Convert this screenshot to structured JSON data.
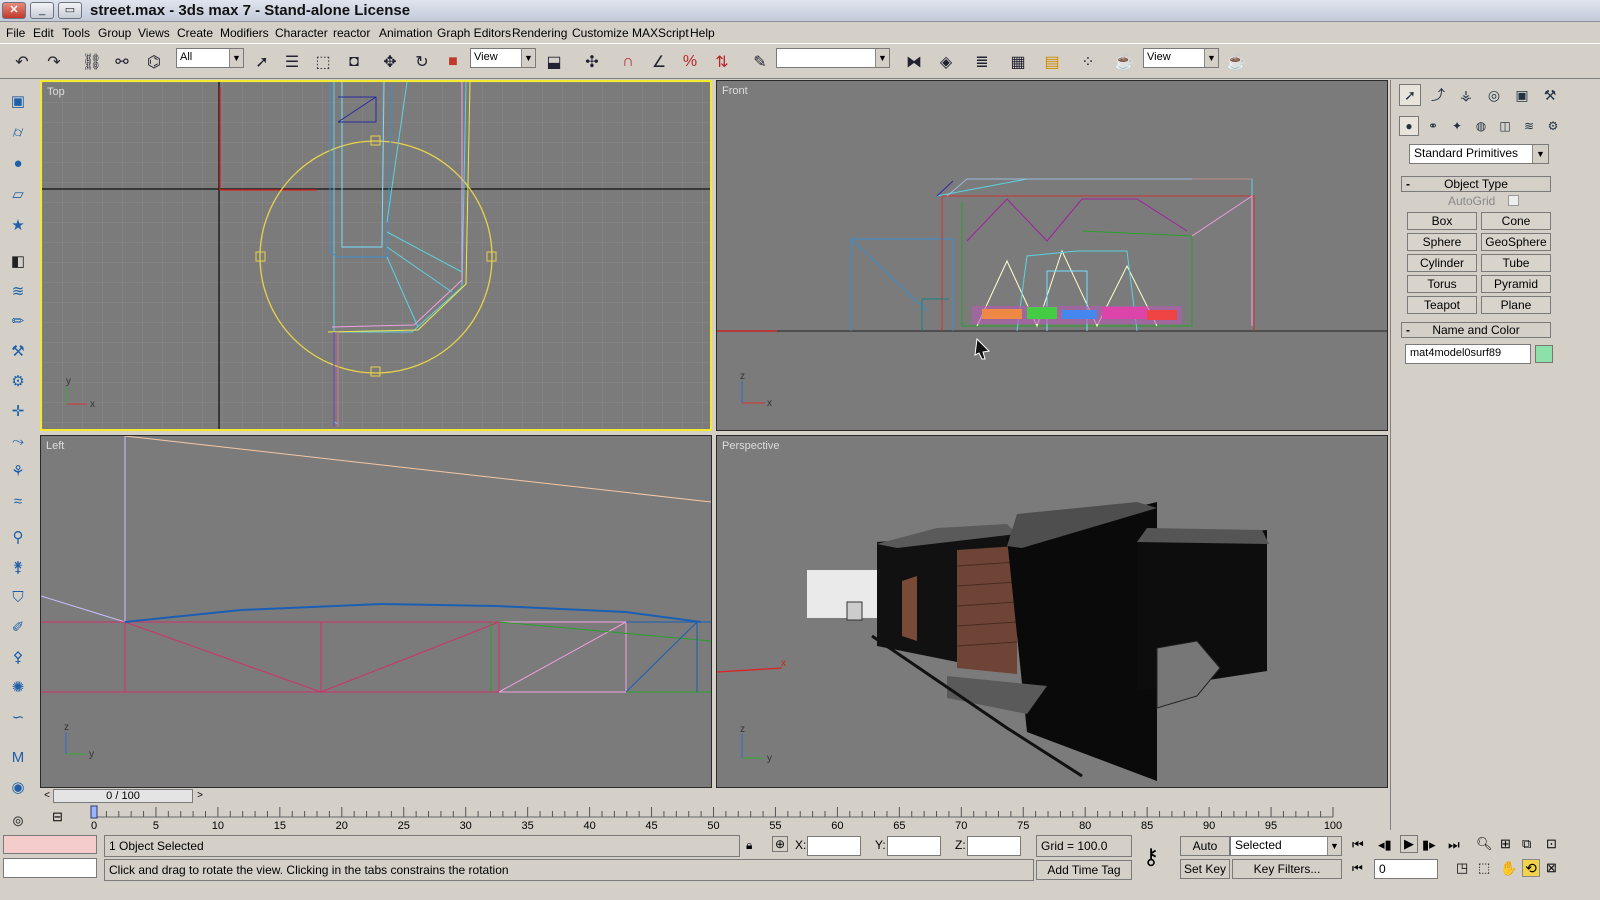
{
  "window": {
    "title": "street.max - 3ds max 7  - Stand-alone License",
    "btn_min": "_",
    "btn_max": "▭",
    "btn_close": "✕"
  },
  "menu": [
    "File",
    "Edit",
    "Tools",
    "Group",
    "Views",
    "Create",
    "Modifiers",
    "Character",
    "reactor",
    "Animation",
    "Graph Editors",
    "Rendering",
    "Customize",
    "MAXScript",
    "Help"
  ],
  "toolbar": {
    "selection_filter": "All",
    "ref_coord": "View",
    "named_selection": "",
    "render_view": "View"
  },
  "viewports": {
    "top": "Top",
    "front": "Front",
    "left": "Left",
    "perspective": "Perspective"
  },
  "axis_labels": {
    "x": "x",
    "y": "y",
    "z": "z"
  },
  "timeline": {
    "slider": "0 / 100",
    "prev": "<",
    "next": ">",
    "ticks": [
      "0",
      "5",
      "10",
      "15",
      "20",
      "25",
      "30",
      "35",
      "40",
      "45",
      "50",
      "55",
      "60",
      "65",
      "70",
      "75",
      "80",
      "85",
      "90",
      "95",
      "100"
    ]
  },
  "status": {
    "selection": "1 Object Selected",
    "prompt": "Click and drag to rotate the view.  Clicking in the tabs constrains the rotation",
    "x_label": "X:",
    "y_label": "Y:",
    "z_label": "Z:",
    "grid": "Grid = 100.0",
    "add_time_tag": "Add Time Tag",
    "auto_key": "Auto Key",
    "set_key": "Set Key",
    "key_mode": "Selected",
    "key_filters": "Key Filters...",
    "frame": "0"
  },
  "command_panel": {
    "category": "Standard Primitives",
    "object_type_header": "Object Type",
    "autogrid": "AutoGrid",
    "buttons": [
      "Box",
      "Cone",
      "Sphere",
      "GeoSphere",
      "Cylinder",
      "Tube",
      "Torus",
      "Pyramid",
      "Teapot",
      "Plane"
    ],
    "name_color_header": "Name and Color",
    "object_name": "mat4model0surf89",
    "object_color": "#8de0a8"
  },
  "colors": {
    "active_viewport": "#f4ea2b",
    "viewport_bg": "#7b7b7b",
    "ui_bg": "#d4d0c8"
  }
}
